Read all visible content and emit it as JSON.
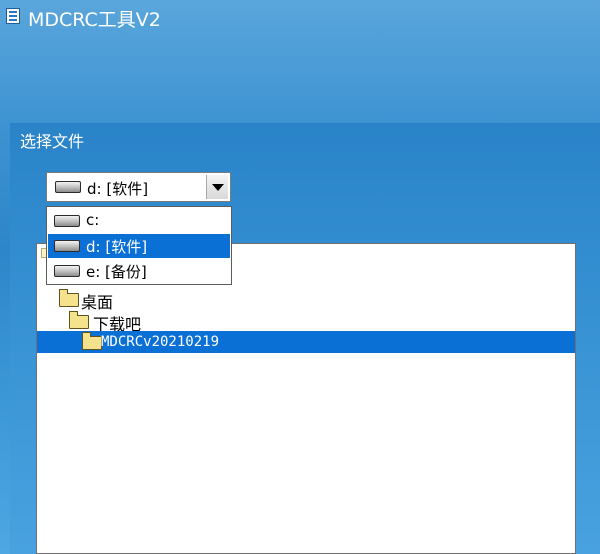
{
  "window": {
    "title": "MDCRC工具V2"
  },
  "section": {
    "label": "选择文件"
  },
  "drive_select": {
    "selected": "d: [软件]",
    "options": [
      "c:",
      "d: [软件]",
      "e: [备份]"
    ],
    "selected_index": 1
  },
  "folder_tree": {
    "items": [
      {
        "label": "桌面",
        "depth": 0,
        "selected": false
      },
      {
        "label": "下载吧",
        "depth": 1,
        "selected": false
      },
      {
        "label": "MDCRCv20210219",
        "depth": 2,
        "selected": true
      }
    ]
  },
  "colors": {
    "selection": "#0a70d6",
    "background": "#3e93d2",
    "folder": "#f4e38c"
  },
  "icons": {
    "app": "document-list-icon",
    "drive": "hard-drive-icon",
    "folder": "folder-icon",
    "dropdown": "triangle-down-icon"
  }
}
